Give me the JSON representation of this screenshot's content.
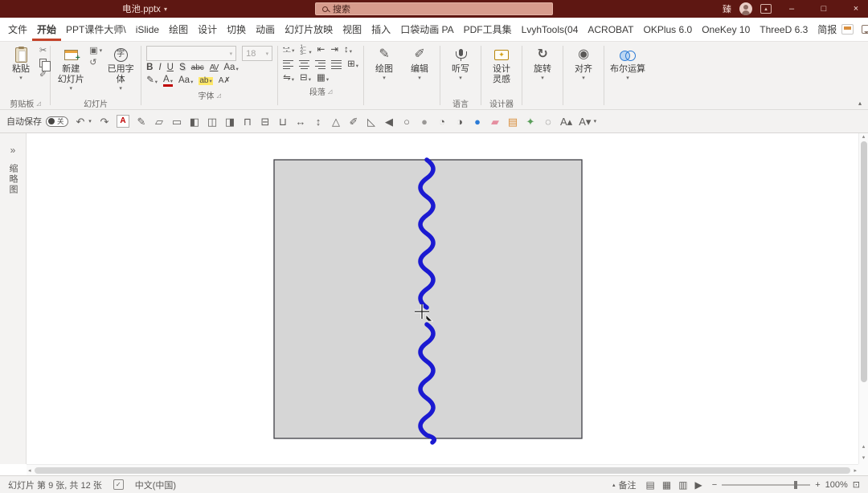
{
  "colors": {
    "titlebar_bg": "#5e1712",
    "search_bg": "#d79c8d",
    "tab_accent": "#c4432a",
    "wave_blue": "#1b1ad1",
    "plugin_blue": "#2b7bd6"
  },
  "titlebar": {
    "title": "电池.pptx",
    "search_placeholder": "搜索",
    "user_name": "臻"
  },
  "tabs": [
    {
      "label": "文件",
      "active": false
    },
    {
      "label": "开始",
      "active": true
    },
    {
      "label": "PPT课件大师\\",
      "active": false
    },
    {
      "label": "iSlide",
      "active": false
    },
    {
      "label": "绘图",
      "active": false
    },
    {
      "label": "设计",
      "active": false
    },
    {
      "label": "切换",
      "active": false
    },
    {
      "label": "动画",
      "active": false
    },
    {
      "label": "幻灯片放映",
      "active": false
    },
    {
      "label": "视图",
      "active": false
    },
    {
      "label": "插入",
      "active": false
    },
    {
      "label": "口袋动画 PA",
      "active": false
    },
    {
      "label": "PDF工具集",
      "active": false
    },
    {
      "label": "LvyhTools(04",
      "active": false
    },
    {
      "label": "ACROBAT",
      "active": false
    },
    {
      "label": "OKPlus 6.0",
      "active": false
    },
    {
      "label": "OneKey 10",
      "active": false
    },
    {
      "label": "ThreeD 6.3",
      "active": false
    },
    {
      "label": "简报",
      "active": false
    }
  ],
  "ribbon": {
    "clipboard": {
      "paste": "粘贴",
      "label": "剪贴板"
    },
    "slides": {
      "new_l1": "新建",
      "new_l2": "幻灯片",
      "font_l1": "已用字",
      "font_l2": "体",
      "label": "幻灯片"
    },
    "font": {
      "size": "18",
      "label": "字体"
    },
    "paragraph": {
      "label": "段落"
    },
    "draw": "绘图",
    "editing": "编辑",
    "dictate": "听写",
    "language_label": "语言",
    "design_l1": "设计",
    "design_l2": "灵感",
    "designer_label": "设计器",
    "rotate": "旋转",
    "align": "对齐",
    "boolean": "布尔运算"
  },
  "qat": {
    "autosave_label": "自动保存",
    "autosave_state": "关",
    "tools": [
      {
        "name": "undo-button",
        "glyph": "↶"
      },
      {
        "name": "undo-caret",
        "glyph": "▾",
        "cls": "sm"
      },
      {
        "name": "redo-button",
        "glyph": "↷"
      },
      {
        "name": "text-style-tool",
        "glyph": "A",
        "cls": "boxed red"
      },
      {
        "name": "draw-pen-tool",
        "glyph": "✎"
      },
      {
        "name": "freeform-tool",
        "glyph": "▱"
      },
      {
        "name": "rectangle-tool",
        "glyph": "▭"
      },
      {
        "name": "align-left-tool",
        "glyph": "◧"
      },
      {
        "name": "align-center-tool",
        "glyph": "◫"
      },
      {
        "name": "align-right-tool",
        "glyph": "◨"
      },
      {
        "name": "align-top-tool",
        "glyph": "⊓"
      },
      {
        "name": "align-middle-tool",
        "glyph": "⊟"
      },
      {
        "name": "align-bottom-tool",
        "glyph": "⊔"
      },
      {
        "name": "distribute-h-tool",
        "glyph": "↔"
      },
      {
        "name": "distribute-v-tool",
        "glyph": "↕"
      },
      {
        "name": "triangle-tool",
        "glyph": "△"
      },
      {
        "name": "pencil-tool",
        "glyph": "✐"
      },
      {
        "name": "curve-tool",
        "glyph": "◺"
      },
      {
        "name": "flip-tool",
        "glyph": "◀"
      },
      {
        "name": "ellipse-tool",
        "glyph": "○"
      },
      {
        "name": "oval-tool",
        "glyph": "●",
        "cls": "c-gray"
      },
      {
        "name": "pie-tool",
        "glyph": "◔"
      },
      {
        "name": "half-circle-tool",
        "glyph": "◑"
      },
      {
        "name": "blue-circle-tool",
        "glyph": "●",
        "cls": "c-blue"
      },
      {
        "name": "eraser-tool",
        "glyph": "▰",
        "cls": "c-pink"
      },
      {
        "name": "notebook-tool",
        "glyph": "▤",
        "cls": "c-orange"
      },
      {
        "name": "sparkle-tool",
        "glyph": "✦",
        "cls": "c-green"
      },
      {
        "name": "ring-tool",
        "glyph": "◌"
      },
      {
        "name": "grow-font-tool",
        "glyph": "A▴"
      },
      {
        "name": "shrink-font-tool",
        "glyph": "A▾"
      },
      {
        "name": "more-tools-button",
        "glyph": "▾",
        "cls": "sm"
      }
    ]
  },
  "panel": {
    "thumbnails": "缩略图"
  },
  "slide": {
    "rect_fill": "#d6d6d6",
    "rect_stroke": "#3f3f46",
    "wave_color": "#1b1ad1"
  },
  "statusbar": {
    "slide_info": "幻灯片 第 9 张, 共 12 张",
    "language": "中文(中国)",
    "notes": "备注",
    "zoom": "100%"
  },
  "icons": {
    "caret_down": "▾",
    "caret_up": "▴",
    "launcher": "◿",
    "chevrons": "»",
    "cut": "✂",
    "painter": "✐",
    "layout": "▣",
    "reset": "↺",
    "zi": "字",
    "bold": "B",
    "italic": "I",
    "underline": "U",
    "shadow": "S",
    "strike": "abc",
    "kerning": "AV",
    "case_btn": "Aa",
    "pen": "✎",
    "edit_pen": "✐",
    "fontcolor": "A",
    "highlight": "ab",
    "clear_format": "A✗",
    "indent_dec": "⇤",
    "indent_inc": "⇥",
    "spacing": "↕",
    "columns": "⊞",
    "textdir": "⇋",
    "aligntext": "⊟",
    "smartart": "▦",
    "bullets": "•–•–•–",
    "numbering": "1–2–3–",
    "rotate": "↻",
    "align_circle": "◉",
    "sparkle": "✦",
    "min": "–",
    "max": "□",
    "close": "×",
    "up": "▴",
    "down": "▾",
    "left": "◂",
    "right": "▸",
    "notes_g": "▴",
    "spell": "✓",
    "fit": "⊡",
    "zoom_out": "−",
    "zoom_in": "+",
    "view_normal": "▤",
    "view_sorter": "▦",
    "view_reading": "▥",
    "view_show": "▶"
  }
}
